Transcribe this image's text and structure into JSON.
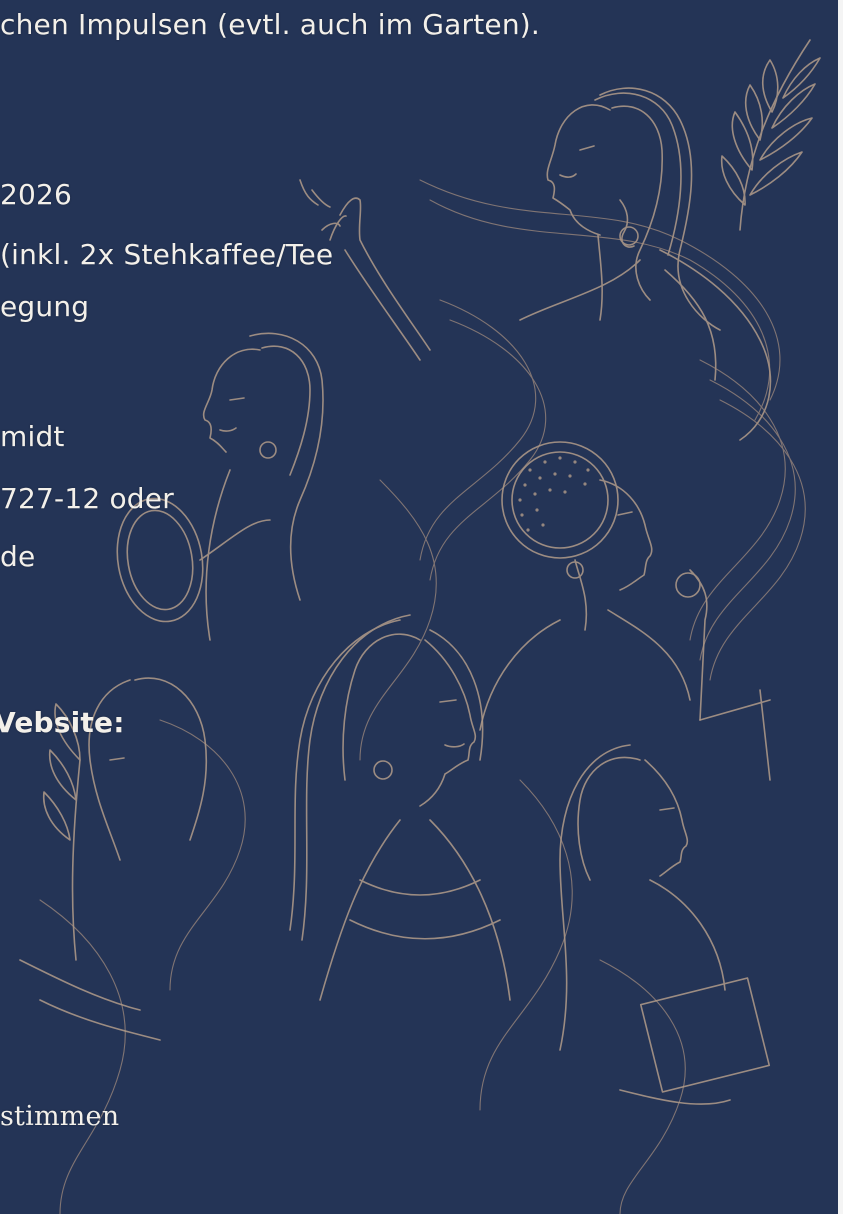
{
  "colors": {
    "background": "#243456",
    "text": "#f3f0ea",
    "line_art": "#b29c8a"
  },
  "text_lines": {
    "line1": "chen Impulsen (evtl. auch im Garten).",
    "line2": "2026",
    "line3": " (inkl. 2x Stehkaffee/Tee",
    "line4": "egung",
    "line5": "midt",
    "line6": "727-12 oder",
    "line7": "de",
    "line8": "Vebsite:",
    "line9": "stimmen"
  },
  "illustration": {
    "icon": "women-line-art-icon"
  }
}
